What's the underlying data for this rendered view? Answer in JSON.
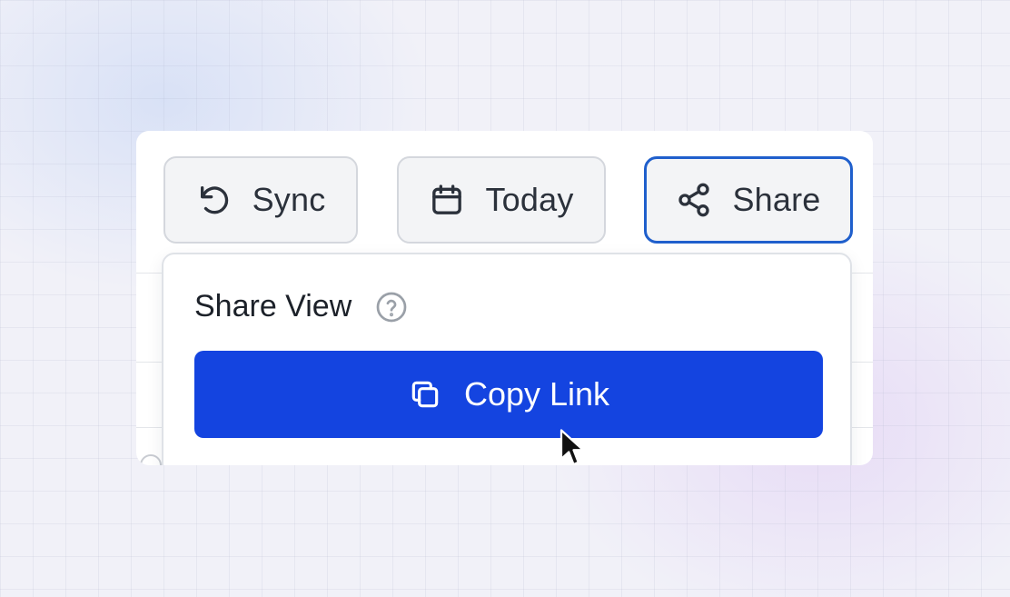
{
  "toolbar": {
    "sync_label": "Sync",
    "today_label": "Today",
    "share_label": "Share",
    "icons": {
      "sync": "refresh-icon",
      "today": "calendar-icon",
      "share": "share-nodes-icon"
    }
  },
  "share_popover": {
    "title": "Share View",
    "help_icon": "question-circle-icon",
    "copy_label": "Copy Link",
    "copy_icon": "copy-icon"
  },
  "colors": {
    "primary": "#1444e0",
    "focus_border": "#1f5fcc",
    "button_bg": "#f3f4f6",
    "text": "#2b313b"
  }
}
